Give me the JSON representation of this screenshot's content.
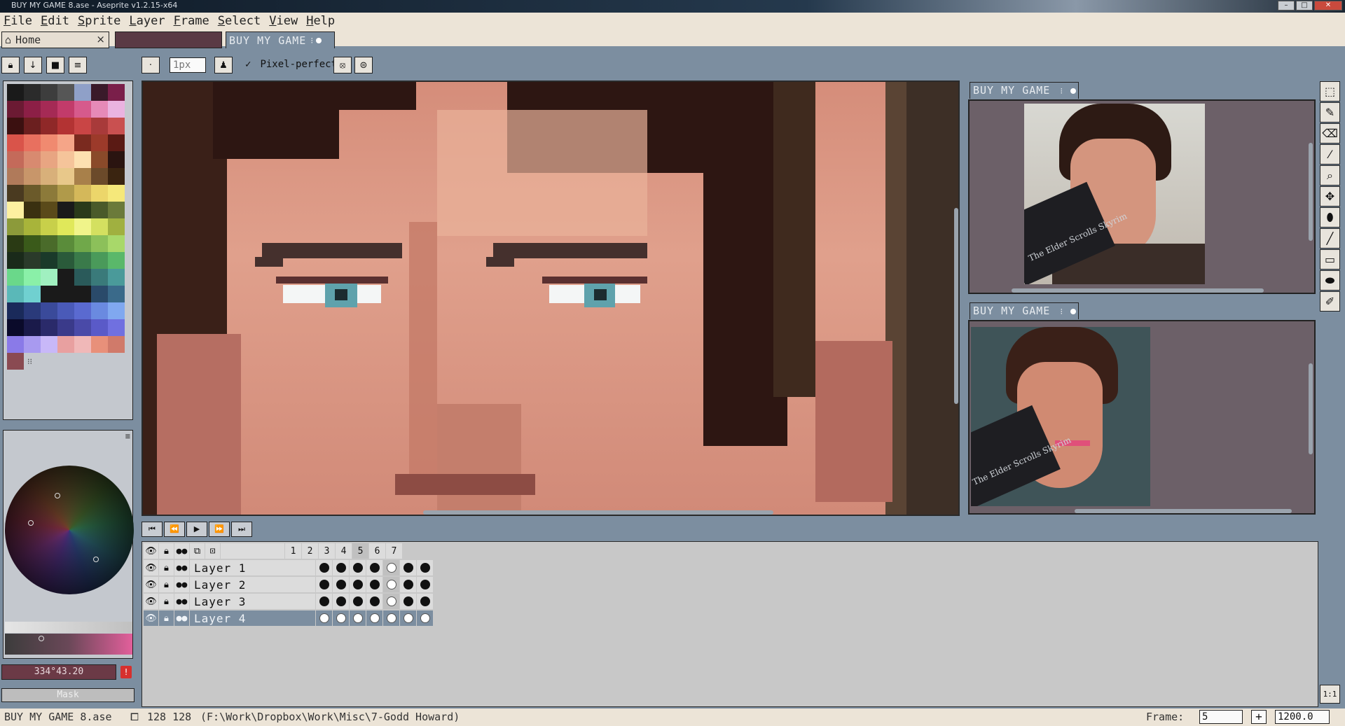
{
  "window": {
    "title": "BUY MY GAME 8.ase - Aseprite v1.2.15-x64"
  },
  "menu": [
    "File",
    "Edit",
    "Sprite",
    "Layer",
    "Frame",
    "Select",
    "View",
    "Help"
  ],
  "tabs": {
    "home": "Home",
    "home_close": "×",
    "active": "BUY MY GAME"
  },
  "toolbar": {
    "brush_size": "1px",
    "pixel_perfect": "Pixel-perfect",
    "pixel_perfect_checked": true
  },
  "palette": {
    "colors": [
      "#1a1a1a",
      "#2b2b2b",
      "#3d3d3d",
      "#565656",
      "#8fa0c8",
      "#3a1a2a",
      "#7a1f4a",
      "#6b1a33",
      "#8c1f46",
      "#a52a55",
      "#c23b6a",
      "#d65a8c",
      "#e68ab8",
      "#eab3e0",
      "#3b1010",
      "#6b1f1f",
      "#8f2828",
      "#b33333",
      "#c94545",
      "#a83a3a",
      "#c95050",
      "#d9544a",
      "#e8705f",
      "#f08a70",
      "#f5a588",
      "#7a2a1f",
      "#9c3a2a",
      "#5a1a14",
      "#c46a5a",
      "#d88a70",
      "#e8a582",
      "#f5c49a",
      "#fde0b0",
      "#8a4a2a",
      "#2a1410",
      "#b07a5a",
      "#c8966a",
      "#d8b07a",
      "#e8c88a",
      "#a8804a",
      "#6b4a2a",
      "#3a2410",
      "#4a3a20",
      "#6b5a2a",
      "#8c7a3a",
      "#b09a4a",
      "#d4b85a",
      "#ecd66a",
      "#f5e87a",
      "#fdf0a0",
      "#3a3010",
      "#5a4a1a",
      "#1a1a1a",
      "#2a3a1a",
      "#4a5a2a",
      "#6b7a3a",
      "#8c9a3a",
      "#a8b43a",
      "#c8d04a",
      "#e0e85a",
      "#f0f48a",
      "#d4e060",
      "#a0b040",
      "#2a3a14",
      "#3a5a1a",
      "#4a6b2a",
      "#5a8c3a",
      "#70a84a",
      "#8cc05a",
      "#a8d86a",
      "#1a2a1a",
      "#2a3a2a",
      "#1a3a2a",
      "#2a5a3a",
      "#3a7a4a",
      "#4a9a5a",
      "#5ab86a",
      "#6ad88a",
      "#8af0a8",
      "#a0f0c0",
      "#1a1a1a",
      "#2a5a5a",
      "#3a7a7a",
      "#4a9a9a",
      "#5ab8b8",
      "#70d0d0",
      "#1a1a1a",
      "#1a1a1a",
      "#1a1a1a",
      "#2a4a6a",
      "#3a6a8a",
      "#1a2a5a",
      "#2a3a7a",
      "#3a4a9a",
      "#4a5ab8",
      "#5a6ad0",
      "#6a8ae0",
      "#80a8f0",
      "#0a0a2a",
      "#1a1a4a",
      "#2a2a6a",
      "#3a3a8a",
      "#4a4aa8",
      "#5a5ac8",
      "#7070e0",
      "#8a7ae8",
      "#a89af0",
      "#c8b8f8",
      "#e8a0a0",
      "#f0b8b8",
      "#e8907a",
      "#d07a6a",
      "#8a4a52"
    ]
  },
  "color_field": "334°43.20",
  "warning_icon": "!",
  "mask_button": "Mask",
  "previews": [
    {
      "title": "BUY MY GAME"
    },
    {
      "title": "BUY MY GAME"
    }
  ],
  "tools": [
    {
      "name": "rect-marquee-icon",
      "glyph": "⬚"
    },
    {
      "name": "pencil-icon",
      "glyph": "✎"
    },
    {
      "name": "eraser-icon",
      "glyph": "⌫"
    },
    {
      "name": "eyedropper-icon",
      "glyph": "⁄"
    },
    {
      "name": "zoom-icon",
      "glyph": "⌕"
    },
    {
      "name": "move-icon",
      "glyph": "✥"
    },
    {
      "name": "paint-bucket-icon",
      "glyph": "⬮"
    },
    {
      "name": "line-icon",
      "glyph": "╱"
    },
    {
      "name": "rectangle-icon",
      "glyph": "▭"
    },
    {
      "name": "contour-icon",
      "glyph": "⬬"
    },
    {
      "name": "blur-icon",
      "glyph": "✐"
    }
  ],
  "zoom_fit_label": "1:1",
  "playback": [
    "⏮",
    "⏪",
    "▶",
    "⏩",
    "⏭"
  ],
  "timeline": {
    "frames": [
      "1",
      "2",
      "3",
      "4",
      "5",
      "6",
      "7"
    ],
    "current_frame_index": 4,
    "layers": [
      {
        "name": "Layer 1",
        "cels": [
          1,
          1,
          1,
          1,
          0,
          1,
          1
        ]
      },
      {
        "name": "Layer 2",
        "cels": [
          1,
          1,
          1,
          1,
          0,
          1,
          1
        ]
      },
      {
        "name": "Layer 3",
        "cels": [
          1,
          1,
          1,
          1,
          0,
          1,
          1
        ]
      },
      {
        "name": "Layer 4",
        "cels": [
          0,
          0,
          0,
          0,
          0,
          0,
          0
        ],
        "selected": true
      }
    ]
  },
  "status": {
    "filename": "BUY MY GAME 8.ase",
    "size": "128 128",
    "path": "(F:\\Work\\Dropbox\\Work\\Misc\\7-Godd Howard)",
    "frame_label": "Frame:",
    "frame_value": "5",
    "zoom_value": "1200.0"
  },
  "preview_text": "The Elder Scrolls Skyrim"
}
